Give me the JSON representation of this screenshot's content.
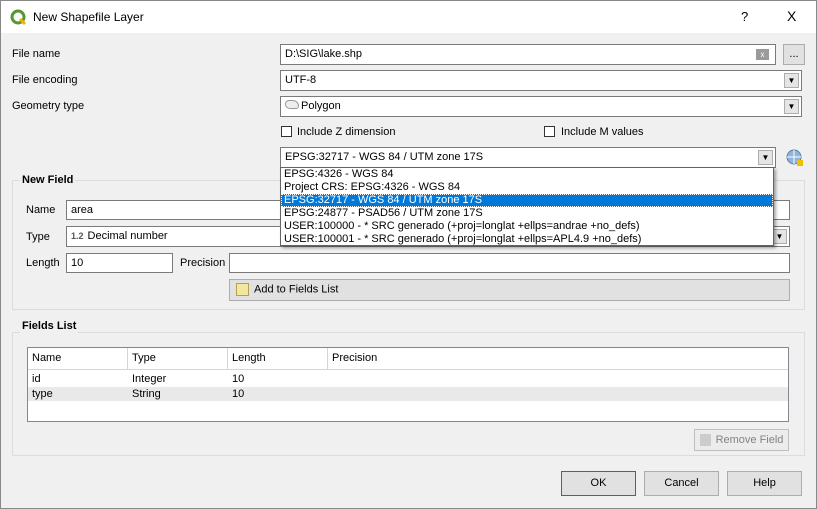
{
  "window": {
    "title": "New Shapefile Layer",
    "help": "?",
    "close": "X"
  },
  "form": {
    "file_name_label": "File name",
    "file_name_value": "D:\\SIG\\lake.shp",
    "browse_label": "...",
    "file_encoding_label": "File encoding",
    "file_encoding_value": "UTF-8",
    "geometry_type_label": "Geometry type",
    "geometry_type_value": "Polygon",
    "include_z_label": "Include Z dimension",
    "include_z_checked": false,
    "include_m_label": "Include M values",
    "include_m_checked": false,
    "crs_value": "EPSG:32717 - WGS 84 / UTM zone 17S",
    "crs_options": [
      "EPSG:4326 - WGS 84",
      "Project CRS: EPSG:4326 - WGS 84",
      "EPSG:32717 - WGS 84 / UTM zone 17S",
      "EPSG:24877 - PSAD56 / UTM zone 17S",
      "USER:100000 -  * SRC generado (+proj=longlat +ellps=andrae +no_defs)",
      "USER:100001 -  * SRC generado (+proj=longlat +ellps=APL4.9 +no_defs)"
    ]
  },
  "new_field": {
    "title": "New Field",
    "name_label": "Name",
    "name_value": "area",
    "type_label": "Type",
    "type_badge": "1.2",
    "type_value": "Decimal number",
    "length_label": "Length",
    "length_value": "10",
    "precision_label": "Precision",
    "precision_value": "",
    "add_button": "Add to Fields List"
  },
  "fields_list": {
    "title": "Fields List",
    "columns": [
      "Name",
      "Type",
      "Length",
      "Precision"
    ],
    "rows": [
      {
        "name": "id",
        "type": "Integer",
        "length": "10",
        "precision": ""
      },
      {
        "name": "type",
        "type": "String",
        "length": "10",
        "precision": ""
      }
    ],
    "remove_button": "Remove Field"
  },
  "buttons": {
    "ok": "OK",
    "cancel": "Cancel",
    "help": "Help"
  },
  "colors": {
    "selection": "#0078d7",
    "accent": "#589632"
  }
}
